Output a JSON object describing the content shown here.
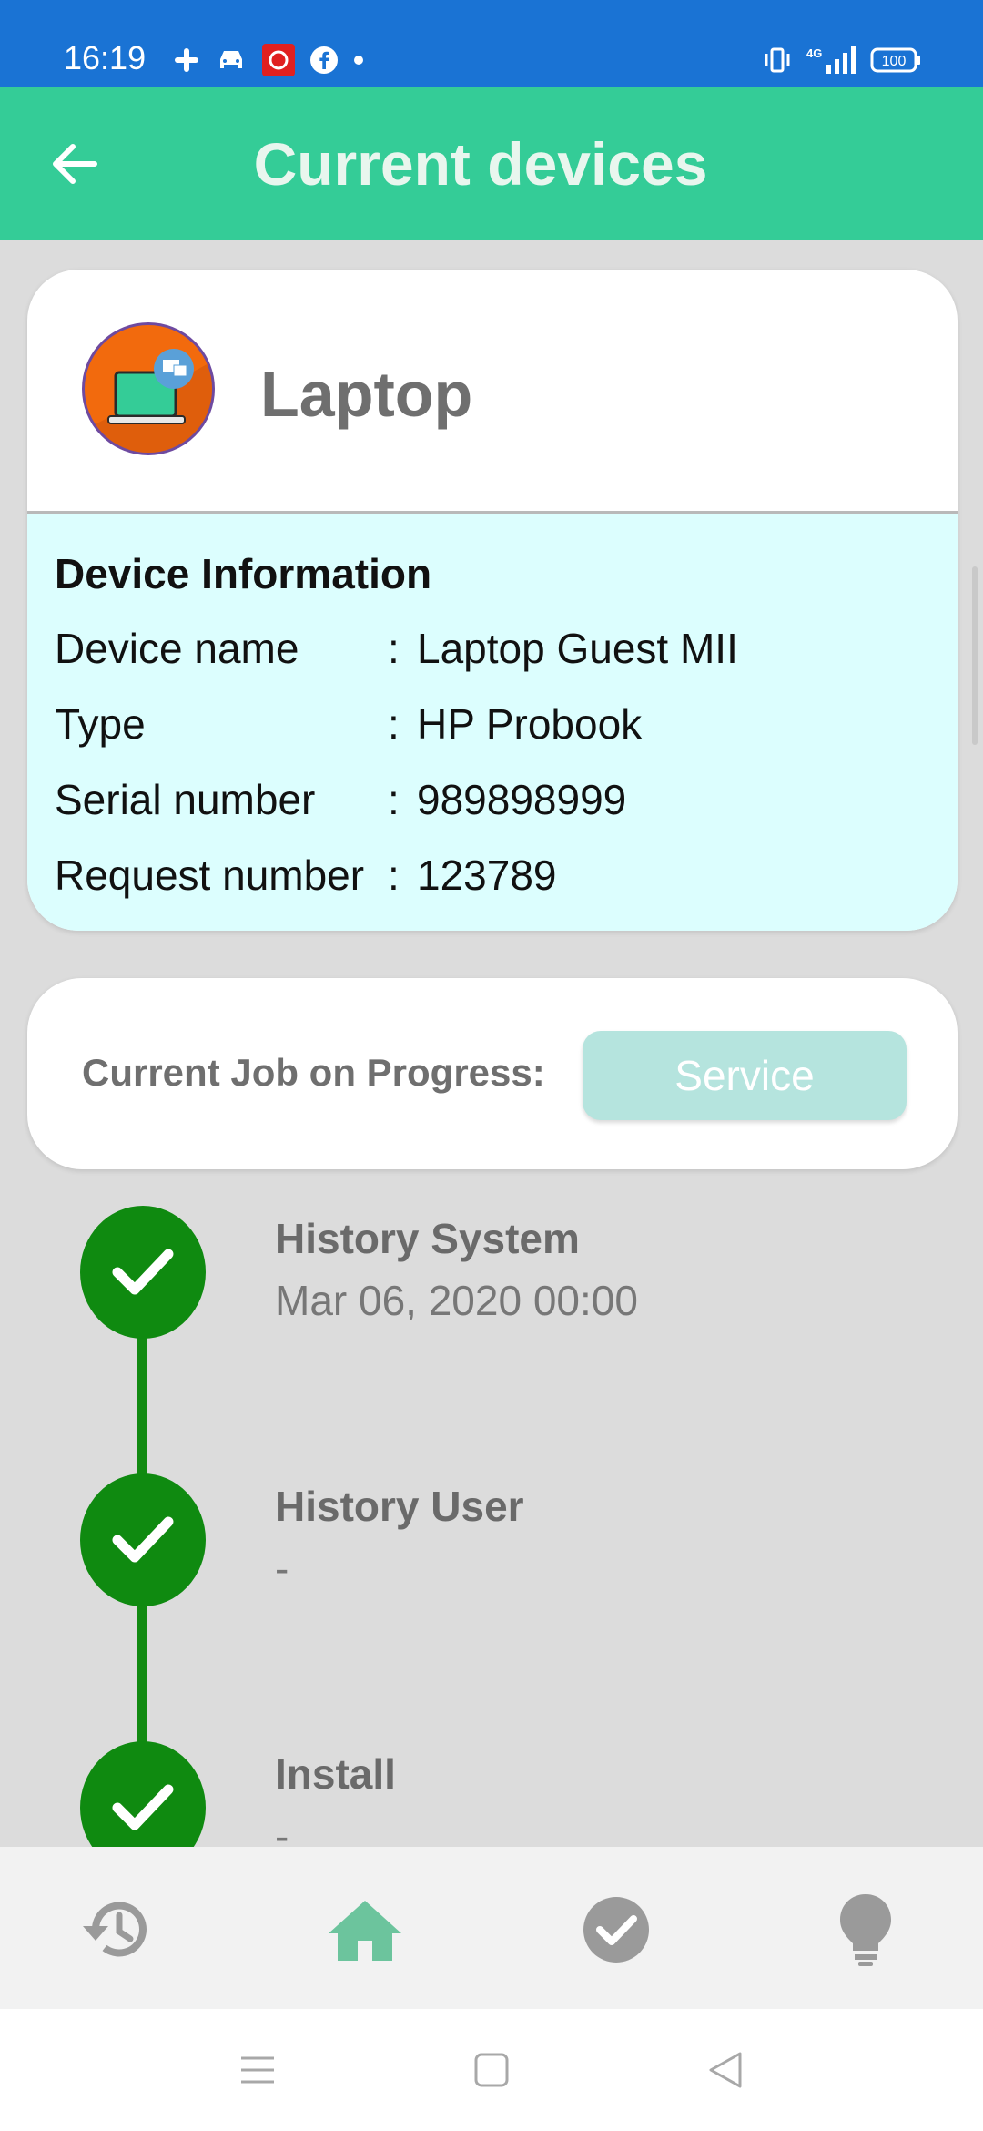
{
  "status_bar": {
    "time": "16:19",
    "left_icons": [
      "slack-icon",
      "car-icon",
      "app-icon",
      "facebook-icon",
      "dot-icon"
    ],
    "right_icons": [
      "vibrate-icon",
      "4g-signal-icon",
      "battery-icon"
    ],
    "battery": "100",
    "network": "4G"
  },
  "app_bar": {
    "title": "Current devices",
    "back_icon": "arrow-left-icon",
    "background": "#34cc97"
  },
  "device": {
    "name": "Laptop",
    "avatar_icon": "laptop-icon",
    "info_heading": "Device Information",
    "rows": [
      {
        "label": "Device name",
        "value": "Laptop Guest MII"
      },
      {
        "label": "Type",
        "value": "HP Probook"
      },
      {
        "label": "Serial number",
        "value": "989898999"
      },
      {
        "label": "Request number",
        "value": "123789"
      }
    ],
    "colon": ":"
  },
  "job": {
    "label": "Current Job on Progress:",
    "button_label": "Service"
  },
  "timeline": [
    {
      "title": "History System",
      "sub": "Mar 06, 2020 00:00"
    },
    {
      "title": "History User",
      "sub": "-"
    },
    {
      "title": "Install",
      "sub": "-"
    }
  ],
  "bottom_nav": [
    {
      "icon": "history-icon",
      "active": false
    },
    {
      "icon": "home-icon",
      "active": true
    },
    {
      "icon": "check-circle-icon",
      "active": false
    },
    {
      "icon": "lightbulb-icon",
      "active": false
    }
  ],
  "colors": {
    "status_bar": "#1a73d4",
    "accent": "#34cc97",
    "check_green": "#0f8a10",
    "info_background": "#dcfefe"
  }
}
